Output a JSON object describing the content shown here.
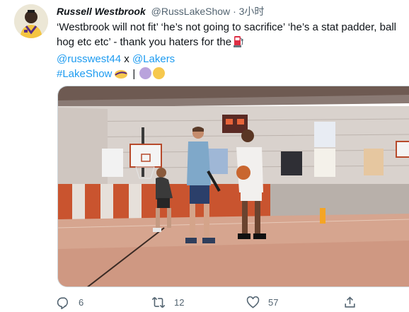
{
  "tweet": {
    "display_name": "Russell Westbrook",
    "handle": "@RussLakeShow",
    "separator": "·",
    "time": "3小时",
    "text_line1": "‘Westbrook will not fit’ ‘he’s not going to sacrifice’ ‘he’s a stat padder, ball",
    "text_line2": "hog etc etc’ - thank you haters for the",
    "mention1": "@russwest44",
    "mention_joiner": " x ",
    "mention2": "@Lakers",
    "hashtag": "#LakeShow",
    "hashtag_pipe": "|",
    "emoji_after_text": "fuel-pump-emoji",
    "circle_colors": [
      "#b9a3dc",
      "#f6c84e"
    ]
  },
  "actions": {
    "reply_count": "6",
    "retweet_count": "12",
    "like_count": "57"
  },
  "colors": {
    "link": "#1d9bf0",
    "muted": "#536471"
  }
}
